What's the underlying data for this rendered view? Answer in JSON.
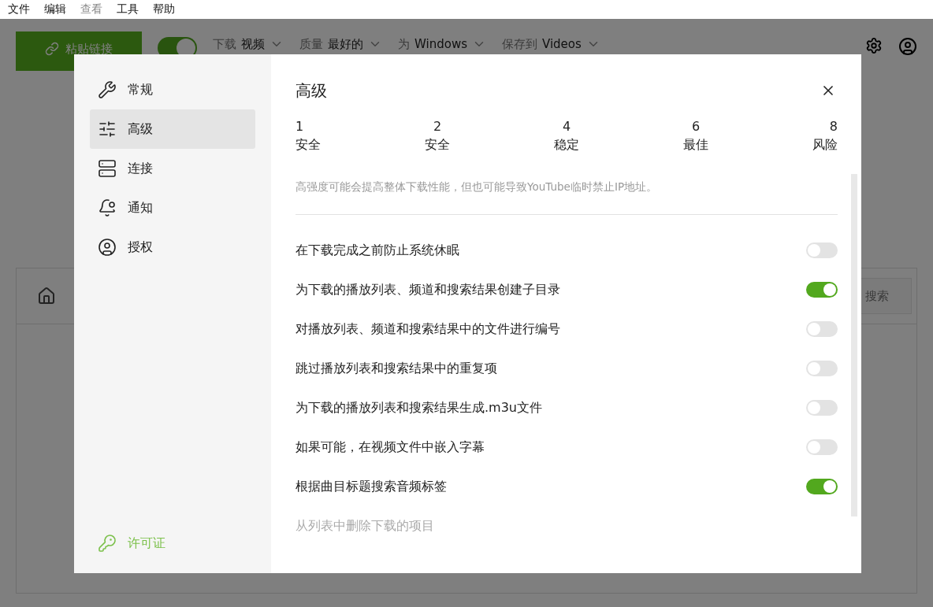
{
  "menu_bar": [
    "文件",
    "编辑",
    "查看",
    "工具",
    "帮助"
  ],
  "toolbar": {
    "paste_button": "粘贴链接",
    "smart_mode_on": true,
    "dropdowns": [
      {
        "label": "下载",
        "value": "视频"
      },
      {
        "label": "质量",
        "value": "最好的"
      },
      {
        "label": "为",
        "value": "Windows"
      },
      {
        "label": "保存到",
        "value": "Videos"
      }
    ]
  },
  "main_panel": {
    "search": {
      "placeholder": "搜索"
    }
  },
  "settings_dialog": {
    "sidebar": {
      "items": [
        {
          "label": "常规",
          "selected": false
        },
        {
          "label": "高级",
          "selected": true
        },
        {
          "label": "连接",
          "selected": false
        },
        {
          "label": "通知",
          "selected": false
        },
        {
          "label": "授权",
          "selected": false
        }
      ],
      "license_link": "许可证"
    },
    "title": "高级",
    "intensity_scale": [
      {
        "value": "1",
        "label": "安全"
      },
      {
        "value": "2",
        "label": "安全"
      },
      {
        "value": "4",
        "label": "稳定"
      },
      {
        "value": "6",
        "label": "最佳"
      },
      {
        "value": "8",
        "label": "风险"
      }
    ],
    "intensity_note": "高强度可能会提高整体下载性能，但也可能导致YouTube临时禁止IP地址。",
    "options": [
      {
        "kind": "toggle",
        "label": "在下载完成之前防止系统休眠",
        "on": false
      },
      {
        "kind": "toggle",
        "label": "为下载的播放列表、频道和搜索结果创建子目录",
        "on": true
      },
      {
        "kind": "toggle",
        "label": "对播放列表、频道和搜索结果中的文件进行编号",
        "on": false
      },
      {
        "kind": "toggle",
        "label": "跳过播放列表和搜索结果中的重复项",
        "on": false
      },
      {
        "kind": "toggle",
        "label": "为下载的播放列表和搜索结果生成.m3u文件",
        "on": false
      },
      {
        "kind": "toggle",
        "label": "如果可能，在视频文件中嵌入字幕",
        "on": false
      },
      {
        "kind": "toggle",
        "label": "根据曲目标题搜索音频标签",
        "on": true
      },
      {
        "kind": "text",
        "label": "从列表中删除下载的项目"
      }
    ]
  }
}
